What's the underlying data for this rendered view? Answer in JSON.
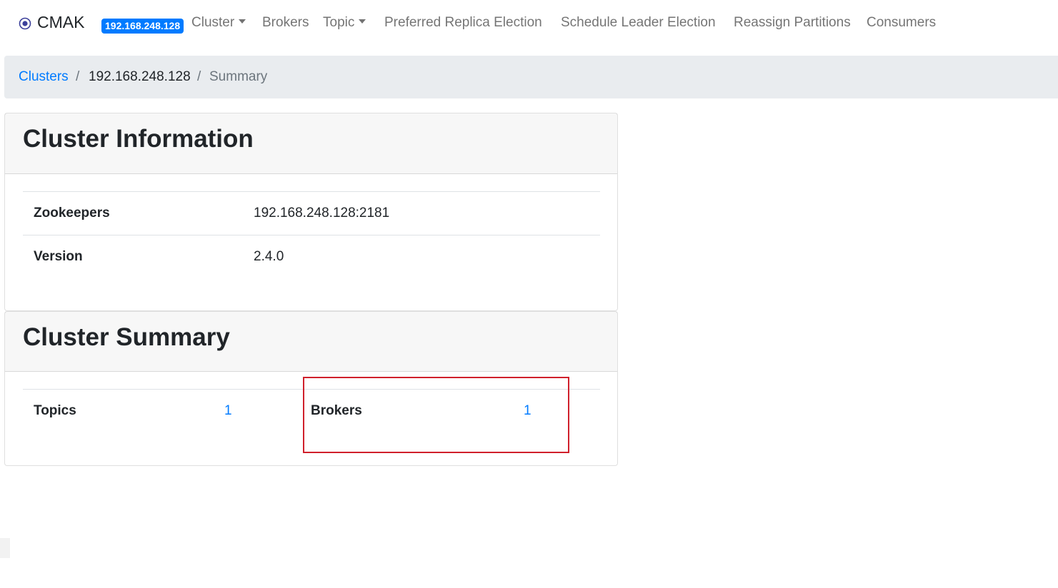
{
  "navbar": {
    "brand": "CMAK",
    "cluster_badge": "192.168.248.128",
    "items": [
      {
        "label": "Cluster",
        "dropdown": true
      },
      {
        "label": "Brokers",
        "dropdown": false
      },
      {
        "label": "Topic",
        "dropdown": true
      },
      {
        "label": "Preferred Replica Election",
        "dropdown": false
      },
      {
        "label": "Schedule Leader Election",
        "dropdown": false
      },
      {
        "label": "Reassign Partitions",
        "dropdown": false
      },
      {
        "label": "Consumers",
        "dropdown": false
      }
    ]
  },
  "breadcrumb": {
    "clusters_link": "Clusters",
    "separator": "/",
    "host": "192.168.248.128",
    "active": "Summary"
  },
  "cluster_information": {
    "title": "Cluster Information",
    "rows": [
      {
        "label": "Zookeepers",
        "value": "192.168.248.128:2181"
      },
      {
        "label": "Version",
        "value": "2.4.0"
      }
    ]
  },
  "cluster_summary": {
    "title": "Cluster Summary",
    "topics_label": "Topics",
    "topics_value": "1",
    "brokers_label": "Brokers",
    "brokers_value": "1"
  },
  "colors": {
    "link": "#007bff",
    "badge_bg": "#007bff",
    "breadcrumb_bg": "#e9ecef",
    "highlight_border": "#d0202c"
  }
}
